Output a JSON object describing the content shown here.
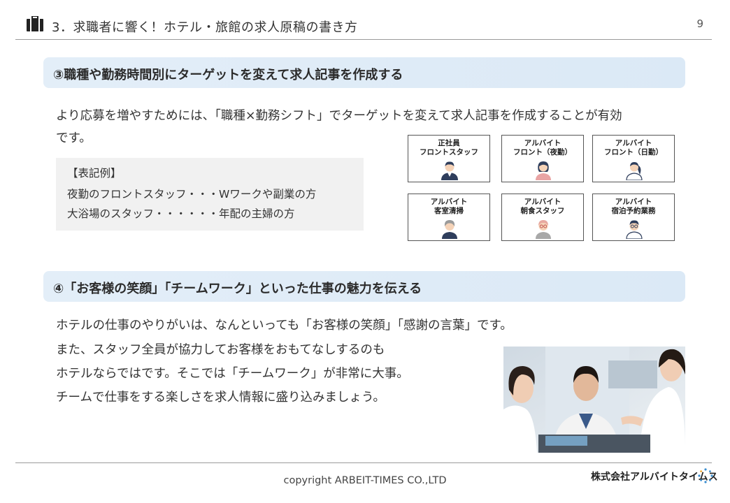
{
  "header": {
    "title": "3．求職者に響く！ホテル・旅館の求人原稿の書き方",
    "page_number": "9",
    "icon": "briefcase-icon"
  },
  "section3": {
    "heading": "③職種や勤務時間別にターゲットを変えて求人記事を作成する",
    "body_line1": "より応募を増やすためには、「職種×勤務シフト」でターゲットを変えて求人記事を作成することが有効",
    "body_line2": "です。",
    "example": {
      "heading": "【表記例】",
      "line1": "夜勤のフロントスタッフ・・・Wワークや副業の方",
      "line2": "大浴場のスタッフ・・・・・・年配の主婦の方"
    },
    "cards": [
      {
        "line1": "正社員",
        "line2": "フロントスタッフ",
        "avatar": "man-suit-avatar-icon"
      },
      {
        "line1": "アルバイト",
        "line2": "フロント（夜勤）",
        "avatar": "woman-avatar-icon"
      },
      {
        "line1": "アルバイト",
        "line2": "フロント（日勤）",
        "avatar": "woman-ponytail-avatar-icon"
      },
      {
        "line1": "アルバイト",
        "line2": "客室清掃",
        "avatar": "gray-hair-avatar-icon"
      },
      {
        "line1": "アルバイト",
        "line2": "朝食スタッフ",
        "avatar": "elderly-glasses-avatar-icon"
      },
      {
        "line1": "アルバイト",
        "line2": "宿泊予約業務",
        "avatar": "man-glasses-avatar-icon"
      }
    ]
  },
  "section4": {
    "heading": "④「お客様の笑顔」「チームワーク」といった仕事の魅力を伝える",
    "line1": "ホテルの仕事のやりがいは、なんといっても「お客様の笑顔」「感謝の言葉」です。",
    "line2": "また、スタッフ全員が協力してお客様をおもてなしするのも",
    "line3": "ホテルならではです。そこでは「チームワーク」が非常に大事。",
    "line4": "チームで仕事をする楽しさを求人情報に盛り込みましょう。"
  },
  "footer": {
    "copyright": "copyright ARBEIT-TIMES CO.,LTD",
    "company": "株式会社アルバイトタイムス",
    "logo_icon": "sparkle-ring-logo-icon"
  },
  "colors": {
    "band": "#dbe9f6",
    "text": "#333333",
    "example_bg": "#f1f1f1",
    "avatar_navy": "#2f3e5c",
    "avatar_skin": "#f5d3b8"
  }
}
